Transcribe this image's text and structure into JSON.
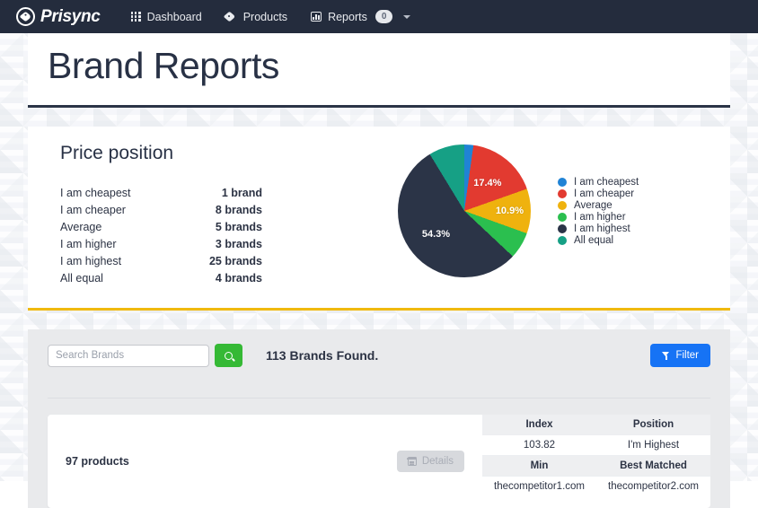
{
  "nav": {
    "brand_name": "Prisync",
    "brand_logo_icon": "price-tag-circle-logo",
    "items": [
      {
        "label": "Dashboard",
        "icon": "grid-icon"
      },
      {
        "label": "Products",
        "icon": "tag-icon"
      },
      {
        "label": "Reports",
        "icon": "bar-chart-icon",
        "badge": "0",
        "caret": true
      }
    ]
  },
  "header": {
    "title": "Brand Reports",
    "accent_color": "#2b3447"
  },
  "price_position": {
    "title": "Price position",
    "accent_color": "#f0b90f",
    "rows": [
      {
        "label": "I am cheapest",
        "value": "1 brand"
      },
      {
        "label": "I am cheaper",
        "value": "8 brands"
      },
      {
        "label": "Average",
        "value": "5 brands"
      },
      {
        "label": "I am higher",
        "value": "3 brands"
      },
      {
        "label": "I am highest",
        "value": "25 brands"
      },
      {
        "label": "All equal",
        "value": "4 brands"
      }
    ]
  },
  "chart_data": {
    "type": "pie",
    "title": "Price position",
    "categories": [
      "I am cheapest",
      "I am cheaper",
      "Average",
      "I am higher",
      "I am highest",
      "All equal"
    ],
    "values": [
      1,
      8,
      5,
      3,
      25,
      4
    ],
    "percentages": [
      2.2,
      17.4,
      10.9,
      6.5,
      54.3,
      8.7
    ],
    "value_unit": "brands",
    "colors": [
      "#2083d5",
      "#e23a30",
      "#efb20e",
      "#2bbf4f",
      "#2b3447",
      "#16a085"
    ],
    "visible_labels": [
      "17.4%",
      "10.9%",
      "54.3%"
    ],
    "legend": {
      "position": "right",
      "entries": [
        {
          "label": "I am cheapest",
          "color": "#2083d5"
        },
        {
          "label": "I am cheaper",
          "color": "#e23a30"
        },
        {
          "label": "Average",
          "color": "#efb20e"
        },
        {
          "label": "I am higher",
          "color": "#2bbf4f"
        },
        {
          "label": "I am highest",
          "color": "#2b3447"
        },
        {
          "label": "All equal",
          "color": "#16a085"
        }
      ]
    }
  },
  "toolbar": {
    "search_placeholder": "Search Brands",
    "search_value": "",
    "search_icon": "magnifier-icon",
    "search_button_color": "#35b935",
    "found_text": "113 Brands Found.",
    "filter_label": "Filter",
    "filter_icon": "funnel-icon",
    "filter_color": "#1673f5"
  },
  "brand_row": {
    "products_count": "97 products",
    "details_label": "Details",
    "details_icon": "calendar-icon",
    "table": {
      "header_1": [
        "Index",
        "Position"
      ],
      "row_1": [
        "103.82",
        "I'm Highest"
      ],
      "header_2": [
        "Min",
        "Best Matched"
      ],
      "row_2": [
        "thecompetitor1.com",
        "thecompetitor2.com"
      ]
    }
  }
}
